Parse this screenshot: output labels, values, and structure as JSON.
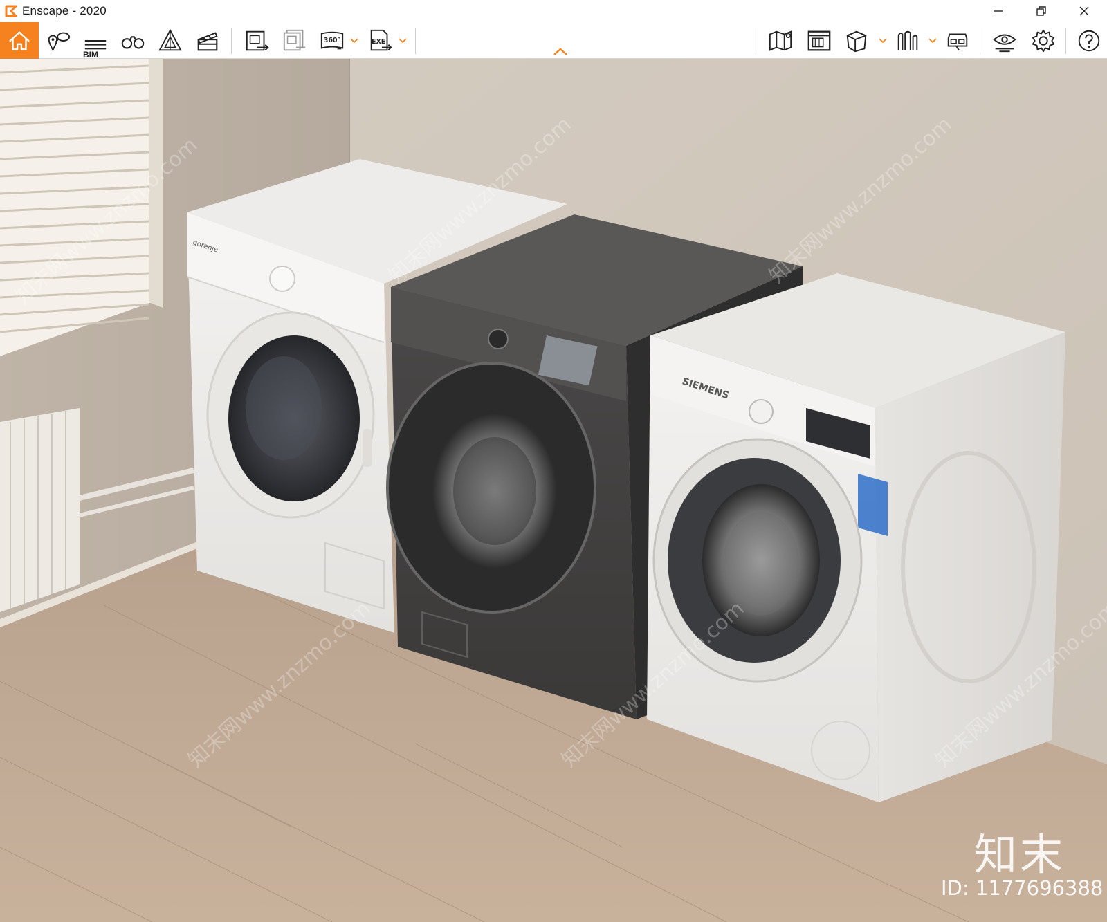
{
  "window": {
    "title": "Enscape - 2020",
    "accent_color": "#f5821f"
  },
  "window_controls": {
    "minimize_icon": "minimize-icon",
    "restore_icon": "restore-icon",
    "close_icon": "close-icon"
  },
  "toolbar": {
    "left_buttons": [
      {
        "name": "home",
        "icon": "home-icon",
        "active": true
      },
      {
        "name": "visual-settings",
        "icon": "location-pin-icon"
      },
      {
        "name": "bim",
        "icon": "bim-list-icon",
        "label": "BIM"
      },
      {
        "name": "look-around",
        "icon": "binoculars-icon"
      },
      {
        "name": "atmosphere",
        "icon": "warning-triangle-icon"
      },
      {
        "name": "video-editor",
        "icon": "clapperboard-icon"
      },
      {
        "name": "render-image",
        "icon": "render-image-icon"
      },
      {
        "name": "batch-render",
        "icon": "batch-render-icon"
      },
      {
        "name": "panorama",
        "icon": "panorama-360-icon",
        "label": "360°"
      },
      {
        "name": "export-exe",
        "icon": "export-exe-icon",
        "label": "EXE"
      }
    ],
    "right_buttons": [
      {
        "name": "map",
        "icon": "map-icon"
      },
      {
        "name": "screenshot-render",
        "icon": "render-window-icon"
      },
      {
        "name": "views",
        "icon": "cube-icon"
      },
      {
        "name": "asset-library",
        "icon": "asset-library-icon"
      },
      {
        "name": "vr-headset",
        "icon": "vr-headset-icon"
      },
      {
        "name": "visual-settings",
        "icon": "eye-icon"
      },
      {
        "name": "settings",
        "icon": "gear-icon"
      },
      {
        "name": "help",
        "icon": "help-icon"
      }
    ],
    "collapse_icon": "chevron-up-icon"
  },
  "viewport": {
    "scene": "Laundry room render with three front-loading washing machines",
    "machine_labels": {
      "left": "gorenje",
      "right": "SIEMENS"
    }
  },
  "watermark": {
    "logo": "知末",
    "id_text": "ID: 1177696388",
    "repeat_text": "知末网www.znzmo.com"
  }
}
